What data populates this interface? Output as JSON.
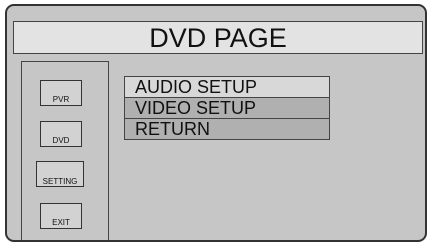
{
  "page": {
    "title": "DVD PAGE"
  },
  "side_buttons": [
    {
      "label": "PVR"
    },
    {
      "label": "DVD"
    },
    {
      "label": "SETTING"
    },
    {
      "label": "EXIT"
    }
  ],
  "menu": {
    "items": [
      {
        "label": "AUDIO SETUP"
      },
      {
        "label": "VIDEO SETUP"
      },
      {
        "label": "RETURN"
      }
    ]
  }
}
